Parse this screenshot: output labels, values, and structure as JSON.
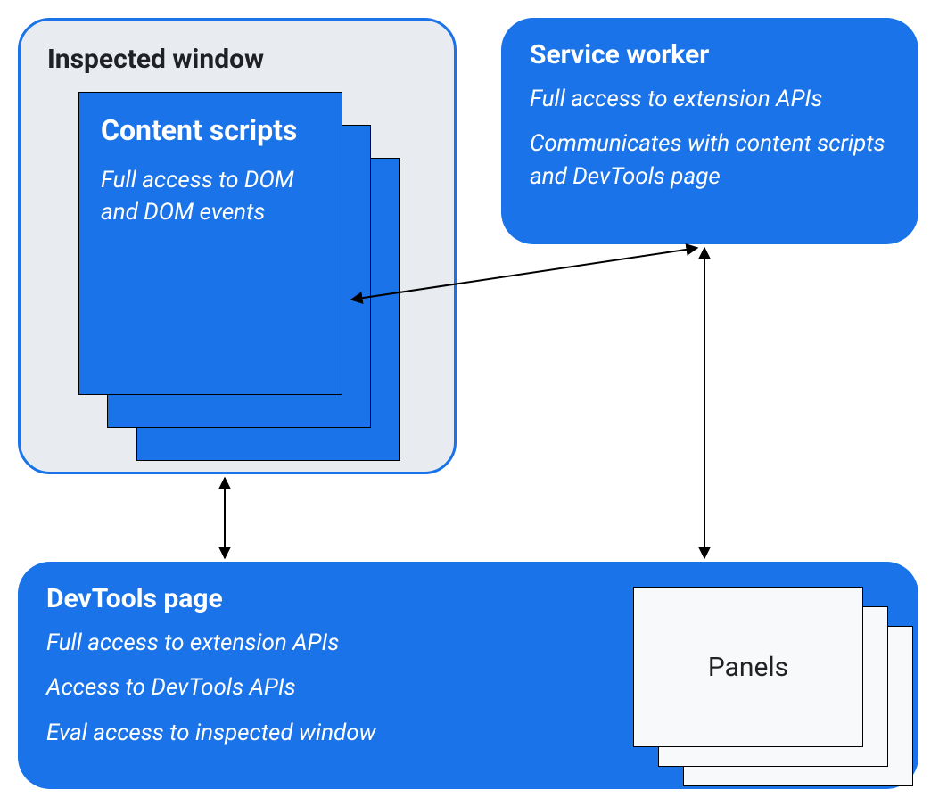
{
  "inspected_window": {
    "title": "Inspected window",
    "content_scripts": {
      "title": "Content scripts",
      "desc": "Full access to DOM and DOM events"
    }
  },
  "service_worker": {
    "title": "Service worker",
    "line1": "Full access to extension APIs",
    "line2": "Communicates with content scripts and DevTools page"
  },
  "devtools_page": {
    "title": "DevTools page",
    "line1": "Full access to extension APIs",
    "line2": "Access to DevTools APIs",
    "line3": "Eval access to inspected window",
    "panels_label": "Panels"
  }
}
